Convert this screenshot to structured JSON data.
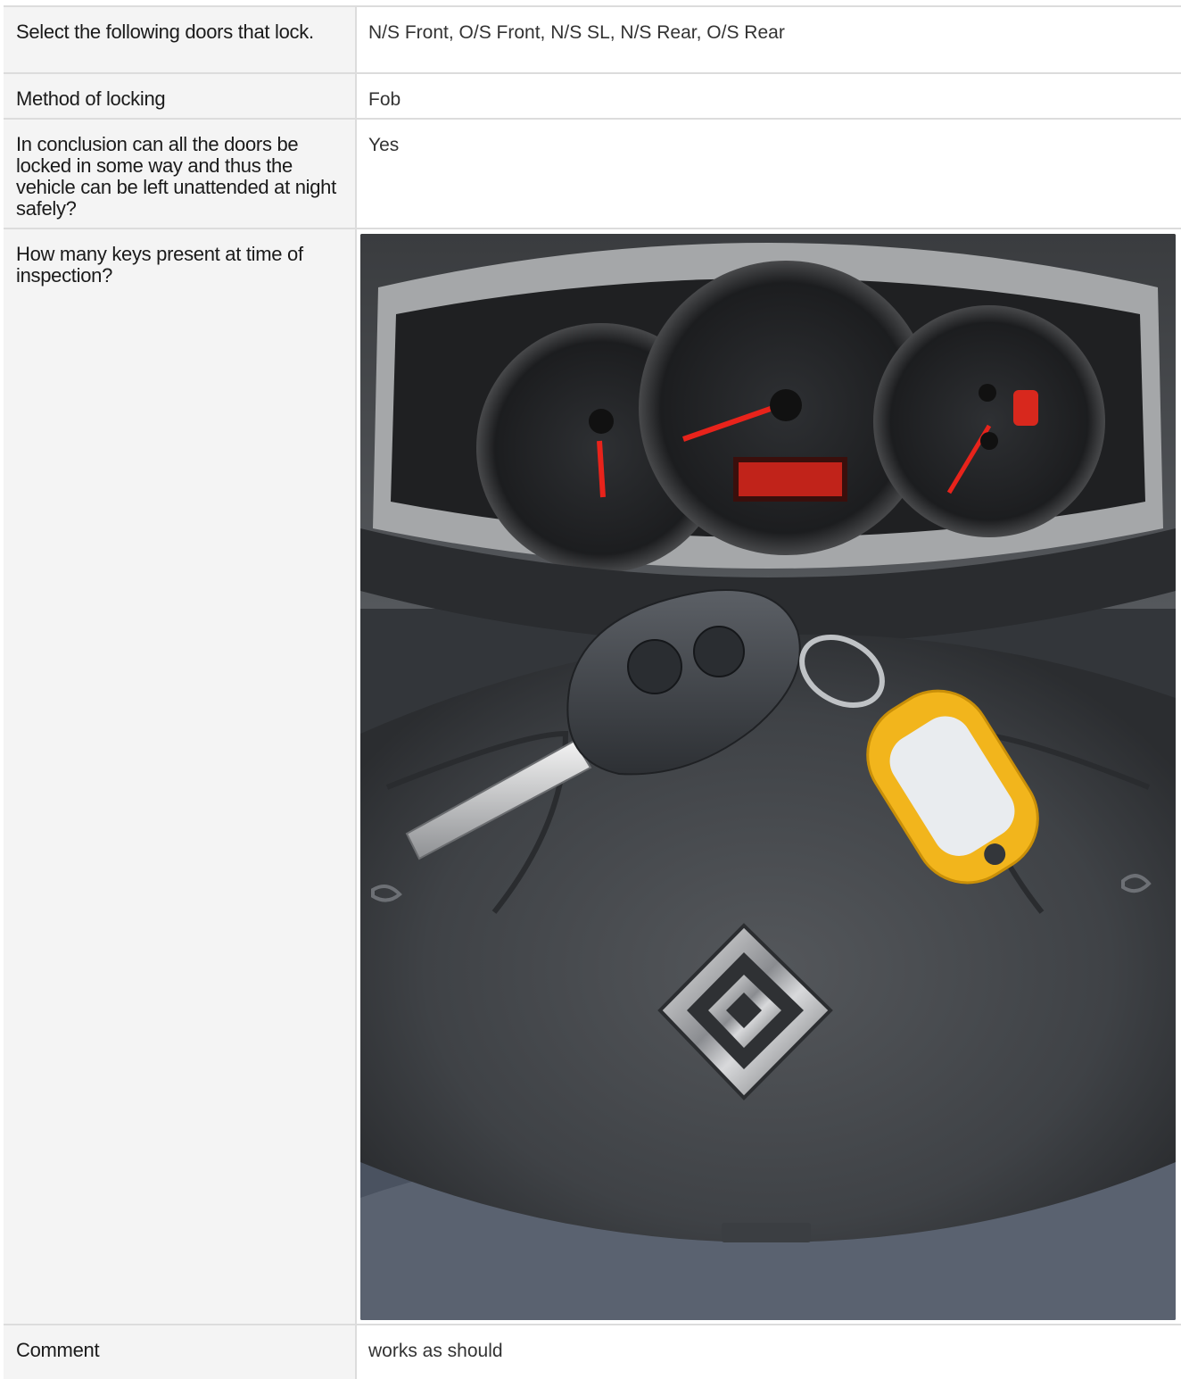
{
  "rows": [
    {
      "label": "Select the following doors that lock.",
      "value": "N/S Front, O/S Front, N/S SL, N/S Rear, O/S Rear"
    },
    {
      "label": "Method of locking",
      "value": "Fob"
    },
    {
      "label": "In conclusion can all the doors be locked in some way and thus the vehicle can be left unattended at night safely?",
      "value": "Yes"
    },
    {
      "label": "How many keys present at time of inspection?",
      "image": "key-on-steering-wheel-photo"
    },
    {
      "label": "Comment",
      "value": "works as should"
    }
  ],
  "colors": {
    "label_background": "#f4f4f4",
    "border": "#dcdcdc",
    "key_tag": "#f2b51c",
    "dash_display": "#e0281e"
  },
  "icons": {
    "brand_badge": "renault-diamond-logo"
  }
}
